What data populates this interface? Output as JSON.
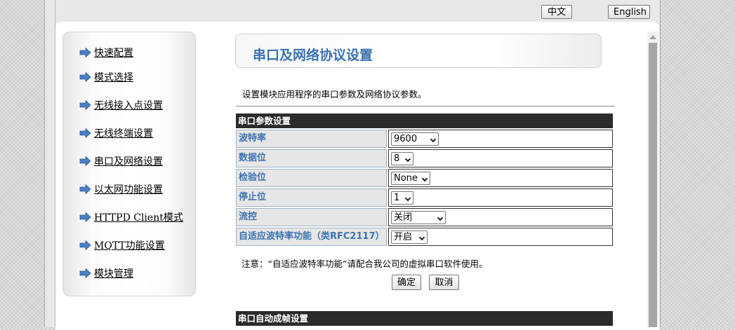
{
  "header": {
    "lang_zh": "中文",
    "lang_en": "English"
  },
  "sidebar": {
    "items": [
      {
        "label": "快速配置"
      },
      {
        "label": "模式选择"
      },
      {
        "label": "无线接入点设置"
      },
      {
        "label": "无线终端设置"
      },
      {
        "label": "串口及网络设置"
      },
      {
        "label": "以太网功能设置"
      },
      {
        "label": "HTTPD Client模式"
      },
      {
        "label": "MQTT功能设置"
      },
      {
        "label": "模块管理"
      }
    ],
    "arrow_color": "#4a7fc1"
  },
  "main": {
    "title": "串口及网络协议设置",
    "description": "设置模块应用程序的串口参数及网络协议参数。",
    "serial_section": {
      "header": "串口参数设置"
    },
    "rows": [
      {
        "label": "波特率",
        "value": "9600"
      },
      {
        "label": "数据位",
        "value": "8"
      },
      {
        "label": "检验位",
        "value": "None"
      },
      {
        "label": "停止位",
        "value": "1"
      },
      {
        "label": "流控",
        "value": "关闭"
      },
      {
        "label": "自适应波特率功能（类RFC2117）",
        "value": "开启"
      }
    ],
    "note": "注意：“自适应波特率功能”请配合我公司的虚拟串口软件使用。",
    "ok_label": "确定",
    "cancel_label": "取消",
    "frame_section": {
      "header": "串口自动成帧设置"
    }
  },
  "colors": {
    "title": "#3b73b0",
    "section_header_bg": "#2b2b2b",
    "label_text": "#3b73b0"
  }
}
